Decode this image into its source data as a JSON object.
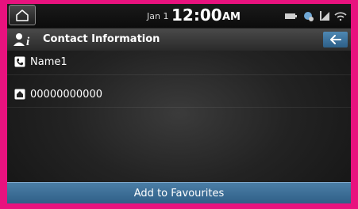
{
  "status_bar": {
    "home_icon": "home-icon",
    "date": "Jan 1",
    "time": "12:00",
    "ampm": "AM",
    "icons": [
      "battery-icon",
      "sync-icon",
      "signal-icon",
      "wifi-icon"
    ]
  },
  "header": {
    "icon": "contact-info-icon",
    "title": "Contact Information",
    "back_icon": "back-arrow-icon"
  },
  "contact": {
    "name_icon": "phonebook-icon",
    "name": "Name1",
    "number_icon": "home-phone-icon",
    "number": "00000000000"
  },
  "actions": {
    "add_favourites": "Add to Favourites"
  },
  "colors": {
    "frame": "#e8127e",
    "button_blue": "#3d6f98"
  }
}
